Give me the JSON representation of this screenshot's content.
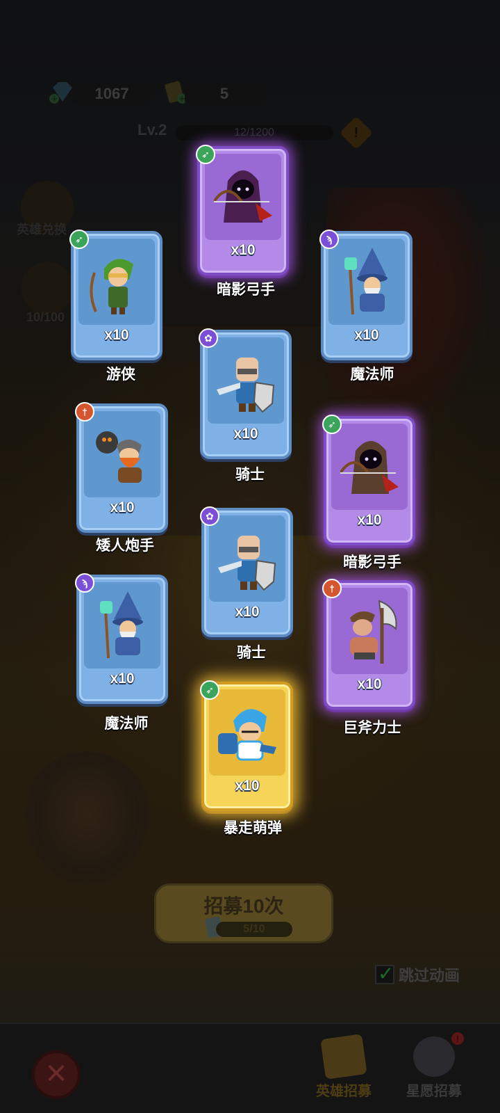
{
  "resources": {
    "gems": "1067",
    "tickets": "5"
  },
  "level": {
    "label": "Lv.2",
    "progress": "12/1200",
    "warn_icon": "!"
  },
  "side": {
    "exchange_label": "英雄兑换",
    "stars_label": "10/100"
  },
  "cards": [
    {
      "name": "暗影弓手",
      "count": "x10",
      "rarity": "epic",
      "class_icon": "bow-icon"
    },
    {
      "name": "游侠",
      "count": "x10",
      "rarity": "rare",
      "class_icon": "bow-icon"
    },
    {
      "name": "魔法师",
      "count": "x10",
      "rarity": "rare",
      "class_icon": "staff-icon"
    },
    {
      "name": "骑士",
      "count": "x10",
      "rarity": "rare",
      "class_icon": "paw-icon"
    },
    {
      "name": "矮人炮手",
      "count": "x10",
      "rarity": "rare",
      "class_icon": "sword-icon"
    },
    {
      "name": "暗影弓手",
      "count": "x10",
      "rarity": "epic",
      "class_icon": "bow-icon"
    },
    {
      "name": "骑士",
      "count": "x10",
      "rarity": "rare",
      "class_icon": "paw-icon"
    },
    {
      "name": "魔法师",
      "count": "x10",
      "rarity": "rare",
      "class_icon": "staff-icon"
    },
    {
      "name": "巨斧力士",
      "count": "x10",
      "rarity": "epic",
      "class_icon": "sword-icon"
    },
    {
      "name": "暴走萌弹",
      "count": "x10",
      "rarity": "legendary",
      "class_icon": "bow-icon"
    }
  ],
  "recruit": {
    "title": "招募10次",
    "progress": "5/10"
  },
  "skip": {
    "label": "跳过动画",
    "checked": true
  },
  "tabs": {
    "close_icon": "✕",
    "hero_recruit": "英雄招募",
    "star_recruit": "星愿招募",
    "notify_mark": "!"
  },
  "colors": {
    "rare": "#7fb1e6",
    "epic": "#b48ae8",
    "legendary": "#f6d457"
  }
}
